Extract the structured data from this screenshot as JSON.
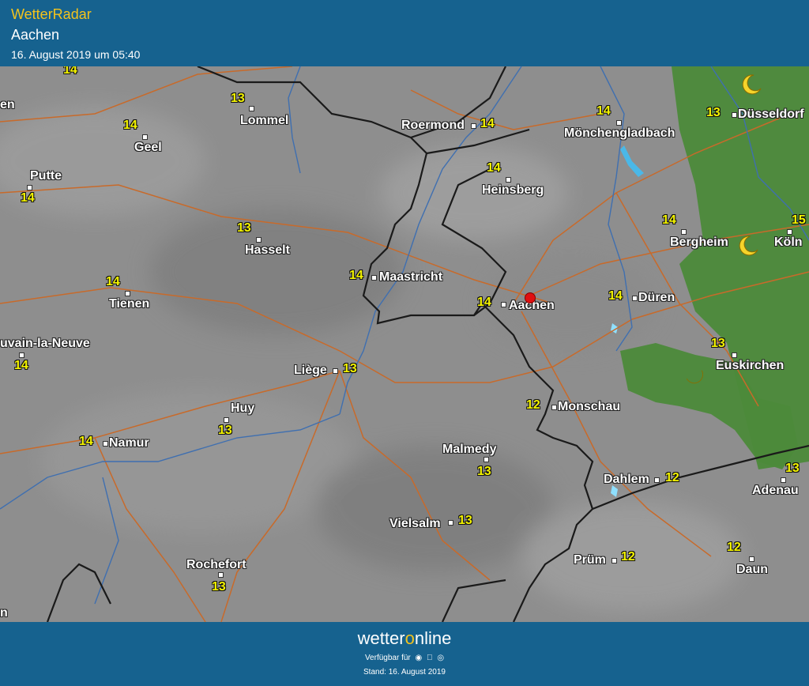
{
  "header": {
    "app_title": "WetterRadar",
    "location": "Aachen",
    "timestamp": "16. August 2019 um 05:40"
  },
  "map": {
    "cities": [
      {
        "name": "Lommel",
        "temp": "13"
      },
      {
        "name": "Roermond",
        "temp": "14"
      },
      {
        "name": "Mönchengladbach",
        "temp": "14"
      },
      {
        "name": "Düsseldorf",
        "temp": "13"
      },
      {
        "name": "Geel",
        "temp": "14"
      },
      {
        "name": "Putte",
        "temp": "14"
      },
      {
        "name": "Heinsberg",
        "temp": "14"
      },
      {
        "name": "Hasselt",
        "temp": "13"
      },
      {
        "name": "Bergheim",
        "temp": "14"
      },
      {
        "name": "Köln",
        "temp": "15"
      },
      {
        "name": "Maastricht",
        "temp": "14"
      },
      {
        "name": "Tienen",
        "temp": "14"
      },
      {
        "name": "Aachen",
        "temp": "14"
      },
      {
        "name": "Düren",
        "temp": "14"
      },
      {
        "name": "uvain-la-Neuve",
        "temp": "14"
      },
      {
        "name": "Liège",
        "temp": "13"
      },
      {
        "name": "Euskirchen",
        "temp": "13"
      },
      {
        "name": "Huy",
        "temp": "13"
      },
      {
        "name": "Monschau",
        "temp": "12"
      },
      {
        "name": "Namur",
        "temp": "14"
      },
      {
        "name": "Malmedy",
        "temp": "13"
      },
      {
        "name": "Dahlem",
        "temp": "12"
      },
      {
        "name": "Adenau",
        "temp": "13"
      },
      {
        "name": "Vielsalm",
        "temp": "13"
      },
      {
        "name": "Prüm",
        "temp": "12"
      },
      {
        "name": "Daun",
        "temp": "12"
      },
      {
        "name": "Rochefort",
        "temp": "13"
      }
    ],
    "edge_labels": {
      "top_temp": "14",
      "left_partial": "en",
      "bottom_left": "n"
    },
    "icons": [
      "moon-icon",
      "location-pin-icon"
    ],
    "colors": {
      "header_bg": "#16628f",
      "title": "#f3c31c",
      "temp": "#f4f400",
      "border": "#1a1a1a",
      "road": "#c86a2a",
      "river": "#3f6fb0",
      "rain_green": "#4c8a3a"
    }
  },
  "footer": {
    "brand_pre": "wetter",
    "brand_o": "o",
    "brand_post": "nline",
    "available_label": "Verfügbar für",
    "platform_icons": [
      "android-icon",
      "apple-icon",
      "web-icon"
    ],
    "stand": "Stand: 16. August 2019"
  }
}
